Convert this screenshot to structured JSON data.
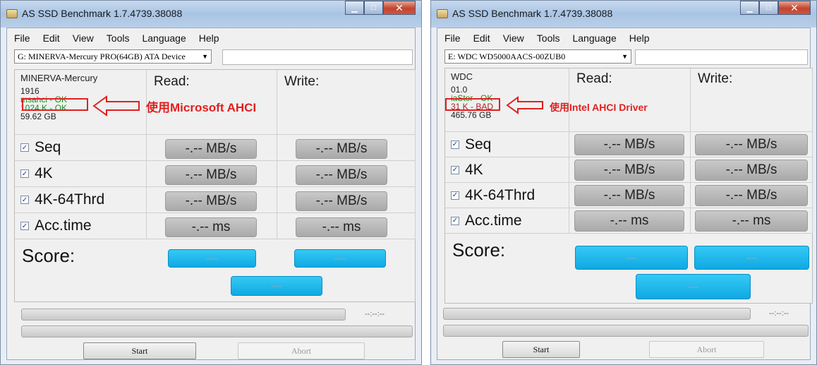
{
  "windows": [
    {
      "title": "AS SSD Benchmark 1.7.4739.38088",
      "menu": [
        "File",
        "Edit",
        "View",
        "Tools",
        "Language",
        "Help"
      ],
      "drive": "G: MINERVA-Mercury PRO(64GB) ATA Device",
      "info": {
        "name": "MINERVA-Mercury",
        "firmware": "1916",
        "driver": "msahci - OK",
        "alignment": "1024 K - OK",
        "size": "59.62 GB"
      },
      "headers": {
        "read": "Read:",
        "write": "Write:"
      },
      "rows": [
        {
          "label": "Seq",
          "read": "-.-- MB/s",
          "write": "-.-- MB/s"
        },
        {
          "label": "4K",
          "read": "-.-- MB/s",
          "write": "-.-- MB/s"
        },
        {
          "label": "4K-64Thrd",
          "read": "-.-- MB/s",
          "write": "-.-- MB/s"
        },
        {
          "label": "Acc.time",
          "read": "-.-- ms",
          "write": "-.-- ms"
        }
      ],
      "score": {
        "label": "Score:",
        "read": "----",
        "write": "----",
        "total": "----"
      },
      "time": "--:--:--",
      "buttons": {
        "start": "Start",
        "abort": "Abort"
      },
      "annotation": "使用Microsoft AHCI"
    },
    {
      "title": "AS SSD Benchmark 1.7.4739.38088",
      "menu": [
        "File",
        "Edit",
        "View",
        "Tools",
        "Language",
        "Help"
      ],
      "drive": "E: WDC WD5000AACS-00ZUB0",
      "info": {
        "name": "WDC",
        "firmware": "01.0",
        "driver": "iaStor - OK",
        "alignment": "31 K - BAD",
        "size": "465.76 GB"
      },
      "headers": {
        "read": "Read:",
        "write": "Write:"
      },
      "rows": [
        {
          "label": "Seq",
          "read": "-.-- MB/s",
          "write": "-.-- MB/s"
        },
        {
          "label": "4K",
          "read": "-.-- MB/s",
          "write": "-.-- MB/s"
        },
        {
          "label": "4K-64Thrd",
          "read": "-.-- MB/s",
          "write": "-.-- MB/s"
        },
        {
          "label": "Acc.time",
          "read": "-.-- ms",
          "write": "-.-- ms"
        }
      ],
      "score": {
        "label": "Score:",
        "read": "----",
        "write": "----",
        "total": "----"
      },
      "time": "--:--:--",
      "buttons": {
        "start": "Start",
        "abort": "Abort"
      },
      "annotation": "使用Intel AHCI Driver"
    }
  ],
  "colors": {
    "annotation": "#e02020",
    "ok_text": "#1d8a1d",
    "bad_text": "#b02020",
    "score_button": "#1ab4ec"
  },
  "icons": {
    "app": "ssd-app-icon",
    "minimize": "minimize-icon",
    "maximize": "maximize-icon",
    "close": "close-icon",
    "dropdown": "chevron-down-icon",
    "checkbox": "checkbox-checked-icon"
  }
}
